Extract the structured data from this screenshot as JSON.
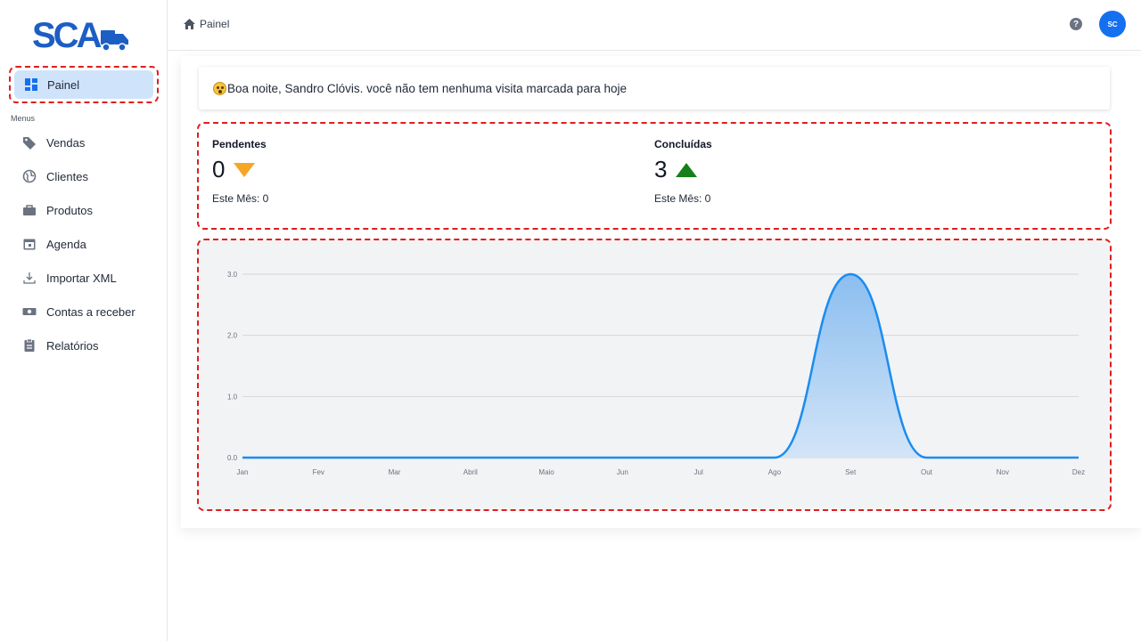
{
  "app": {
    "logo_text": "SCA"
  },
  "sidebar": {
    "active_item": {
      "label": "Painel",
      "icon": "dashboard-icon"
    },
    "section_label": "Menus",
    "items": [
      {
        "label": "Vendas",
        "icon": "tag-icon"
      },
      {
        "label": "Clientes",
        "icon": "globe-icon"
      },
      {
        "label": "Produtos",
        "icon": "shopping-bag-icon"
      },
      {
        "label": "Agenda",
        "icon": "calendar-icon"
      },
      {
        "label": "Importar XML",
        "icon": "download-icon"
      },
      {
        "label": "Contas a receber",
        "icon": "money-icon"
      },
      {
        "label": "Relatórios",
        "icon": "clipboard-icon"
      }
    ]
  },
  "topbar": {
    "breadcrumb": "Painel",
    "help_icon": "help-icon",
    "avatar_initials": "SC"
  },
  "greeting": {
    "text": "Boa noite, Sandro Clóvis. você não tem nenhuma visita marcada para hoje"
  },
  "stats": {
    "pending": {
      "label": "Pendentes",
      "value": "0",
      "month": "Este Mês: 0",
      "trend_color": "#f5a623"
    },
    "done": {
      "label": "Concluídas",
      "value": "3",
      "month": "Este Mês: 0",
      "trend_color": "#15801b"
    }
  },
  "colors": {
    "accent": "#1570ef",
    "line": "#1a8cf0",
    "area": "#a9d1f7"
  },
  "chart_data": {
    "type": "area",
    "categories": [
      "Jan",
      "Fev",
      "Mar",
      "Abril",
      "Maio",
      "Jun",
      "Jul",
      "Ago",
      "Set",
      "Out",
      "Nov",
      "Dez"
    ],
    "values": [
      0,
      0,
      0,
      0,
      0,
      0,
      0,
      0,
      3,
      0,
      0,
      0
    ],
    "ylim": [
      0,
      3
    ],
    "yticks": [
      "0.0",
      "1.0",
      "2.0",
      "3.0"
    ],
    "grid": true,
    "smooth": true
  }
}
